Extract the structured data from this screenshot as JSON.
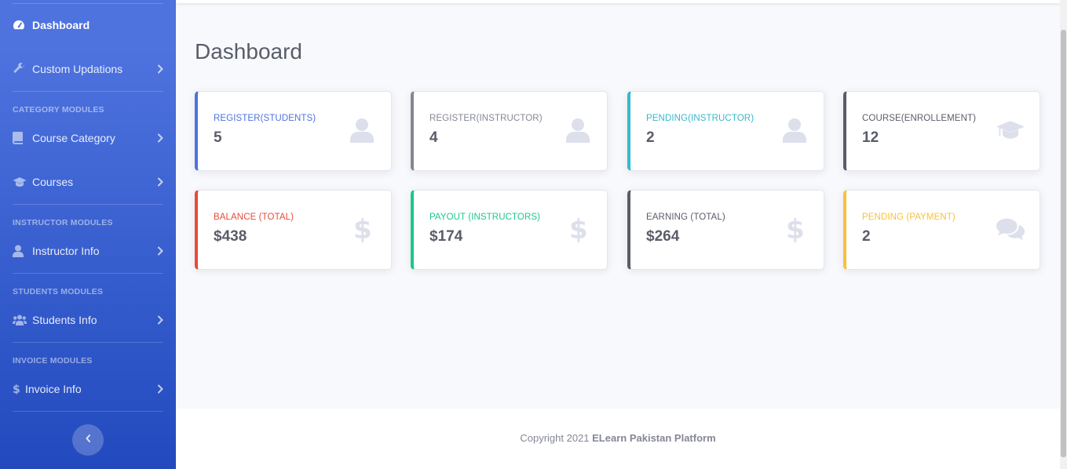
{
  "sidebar": {
    "items": {
      "dashboard": "Dashboard",
      "custom": "Custom Updations",
      "course_category": "Course Category",
      "courses": "Courses",
      "instructor_info": "Instructor Info",
      "students_info": "Students Info",
      "invoice_info": "Invoice Info"
    },
    "headings": {
      "category": "CATEGORY MODULES",
      "instructor": "INSTRUCTOR MODULES",
      "students": "STUDENTS MODULES",
      "invoice": "INVOICE MODULES"
    },
    "icons": {
      "dashboard": "tachometer-icon",
      "custom": "wrench-icon",
      "course_category": "book-icon",
      "courses": "graduation-cap-icon",
      "instructor_info": "user-icon",
      "students_info": "users-icon",
      "invoice_info": "dollar-icon",
      "toggle": "chevron-left-icon"
    }
  },
  "main": {
    "title": "Dashboard",
    "cards": [
      {
        "title": "REGISTER(STUDENTS)",
        "value": "5",
        "color": "#4e73df",
        "icon": "user-icon"
      },
      {
        "title": "REGISTER(INSTRUCTOR)",
        "value": "4",
        "color": "#858796",
        "icon": "user-icon"
      },
      {
        "title": "PENDING(INSTRUCTOR)",
        "value": "2",
        "color": "#36b9cc",
        "icon": "user-icon"
      },
      {
        "title": "COURSE(ENROLLEMENT)",
        "value": "12",
        "color": "#5a5c69",
        "icon": "graduation-cap-icon"
      },
      {
        "title": "BALANCE (TOTAL)",
        "value": "$438",
        "color": "#e74a3b",
        "icon": "dollar-icon"
      },
      {
        "title": "PAYOUT (INSTRUCTORS)",
        "value": "$174",
        "color": "#1cc88a",
        "icon": "dollar-icon"
      },
      {
        "title": "EARNING (TOTAL)",
        "value": "$264",
        "color": "#5a5c69",
        "icon": "dollar-icon"
      },
      {
        "title": "PENDING (PAYMENT)",
        "value": "2",
        "color": "#f6c23e",
        "icon": "comments-icon"
      }
    ]
  },
  "footer": {
    "text": "Copyright 2021 ",
    "brand": "ELearn Pakistan Platform"
  }
}
